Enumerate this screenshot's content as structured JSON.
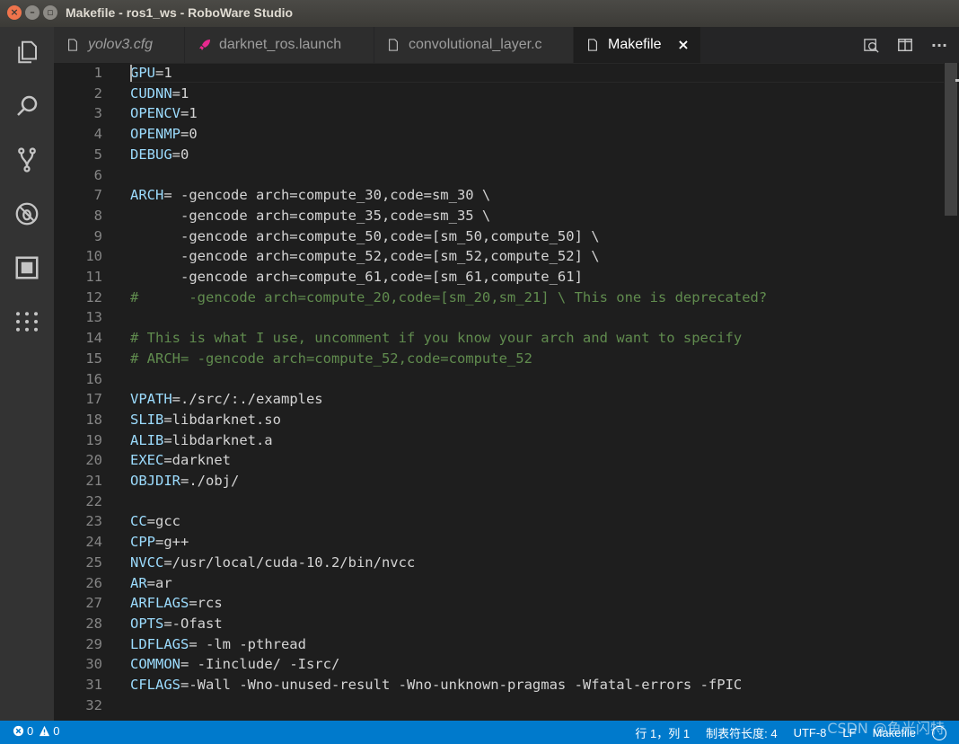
{
  "window": {
    "title": "Makefile - ros1_ws - RoboWare Studio"
  },
  "activity_bar": {
    "items": [
      "explorer-icon",
      "search-icon",
      "source-control-icon",
      "debug-icon",
      "extensions-icon",
      "more-apps-icon"
    ]
  },
  "tabs": [
    {
      "label": "yolov3.cfg",
      "icon": "file-icon",
      "italic": true,
      "active": false
    },
    {
      "label": "darknet_ros.launch",
      "icon": "rocket-icon",
      "italic": false,
      "active": false
    },
    {
      "label": "convolutional_layer.c",
      "icon": "file-icon",
      "italic": false,
      "active": false
    },
    {
      "label": "Makefile",
      "icon": "file-icon",
      "italic": false,
      "active": true,
      "close": "×"
    }
  ],
  "tab_actions": [
    "find-in-files-icon",
    "split-editor-icon",
    "more-actions-icon"
  ],
  "tab_actions_labels": {
    "more": "···"
  },
  "editor": {
    "lines": [
      {
        "n": "1",
        "t": [
          [
            "v",
            "GPU"
          ],
          [
            "x",
            "=1"
          ]
        ]
      },
      {
        "n": "2",
        "t": [
          [
            "v",
            "CUDNN"
          ],
          [
            "x",
            "=1"
          ]
        ]
      },
      {
        "n": "3",
        "t": [
          [
            "v",
            "OPENCV"
          ],
          [
            "x",
            "=1"
          ]
        ]
      },
      {
        "n": "4",
        "t": [
          [
            "v",
            "OPENMP"
          ],
          [
            "x",
            "=0"
          ]
        ]
      },
      {
        "n": "5",
        "t": [
          [
            "v",
            "DEBUG"
          ],
          [
            "x",
            "=0"
          ]
        ]
      },
      {
        "n": "6",
        "t": []
      },
      {
        "n": "7",
        "t": [
          [
            "v",
            "ARCH"
          ],
          [
            "x",
            "= -gencode arch=compute_30,code=sm_30 \\"
          ]
        ]
      },
      {
        "n": "8",
        "t": [
          [
            "x",
            "      -gencode arch=compute_35,code=sm_35 \\"
          ]
        ]
      },
      {
        "n": "9",
        "t": [
          [
            "x",
            "      -gencode arch=compute_50,code=[sm_50,compute_50] \\"
          ]
        ]
      },
      {
        "n": "10",
        "t": [
          [
            "x",
            "      -gencode arch=compute_52,code=[sm_52,compute_52] \\"
          ]
        ]
      },
      {
        "n": "11",
        "t": [
          [
            "x",
            "      -gencode arch=compute_61,code=[sm_61,compute_61]"
          ]
        ]
      },
      {
        "n": "12",
        "t": [
          [
            "c",
            "#      -gencode arch=compute_20,code=[sm_20,sm_21] \\ This one is deprecated?"
          ]
        ]
      },
      {
        "n": "13",
        "t": []
      },
      {
        "n": "14",
        "t": [
          [
            "c",
            "# This is what I use, uncomment if you know your arch and want to specify"
          ]
        ]
      },
      {
        "n": "15",
        "t": [
          [
            "c",
            "# ARCH= -gencode arch=compute_52,code=compute_52"
          ]
        ]
      },
      {
        "n": "16",
        "t": []
      },
      {
        "n": "17",
        "t": [
          [
            "v",
            "VPATH"
          ],
          [
            "x",
            "=./src/:./examples"
          ]
        ]
      },
      {
        "n": "18",
        "t": [
          [
            "v",
            "SLIB"
          ],
          [
            "x",
            "=libdarknet.so"
          ]
        ]
      },
      {
        "n": "19",
        "t": [
          [
            "v",
            "ALIB"
          ],
          [
            "x",
            "=libdarknet.a"
          ]
        ]
      },
      {
        "n": "20",
        "t": [
          [
            "v",
            "EXEC"
          ],
          [
            "x",
            "=darknet"
          ]
        ]
      },
      {
        "n": "21",
        "t": [
          [
            "v",
            "OBJDIR"
          ],
          [
            "x",
            "=./obj/"
          ]
        ]
      },
      {
        "n": "22",
        "t": []
      },
      {
        "n": "23",
        "t": [
          [
            "v",
            "CC"
          ],
          [
            "x",
            "=gcc"
          ]
        ]
      },
      {
        "n": "24",
        "t": [
          [
            "v",
            "CPP"
          ],
          [
            "x",
            "=g++"
          ]
        ]
      },
      {
        "n": "25",
        "t": [
          [
            "v",
            "NVCC"
          ],
          [
            "x",
            "=/usr/local/cuda-10.2/bin/nvcc"
          ]
        ]
      },
      {
        "n": "26",
        "t": [
          [
            "v",
            "AR"
          ],
          [
            "x",
            "=ar"
          ]
        ]
      },
      {
        "n": "27",
        "t": [
          [
            "v",
            "ARFLAGS"
          ],
          [
            "x",
            "=rcs"
          ]
        ]
      },
      {
        "n": "28",
        "t": [
          [
            "v",
            "OPTS"
          ],
          [
            "x",
            "=-Ofast"
          ]
        ]
      },
      {
        "n": "29",
        "t": [
          [
            "v",
            "LDFLAGS"
          ],
          [
            "x",
            "= -lm -pthread"
          ]
        ]
      },
      {
        "n": "30",
        "t": [
          [
            "v",
            "COMMON"
          ],
          [
            "x",
            "= -Iinclude/ -Isrc/"
          ]
        ]
      },
      {
        "n": "31",
        "t": [
          [
            "v",
            "CFLAGS"
          ],
          [
            "x",
            "=-Wall -Wno-unused-result -Wno-unknown-pragmas -Wfatal-errors -fPIC"
          ]
        ]
      },
      {
        "n": "32",
        "t": []
      }
    ]
  },
  "status": {
    "errors": "0",
    "warnings": "0",
    "position": "行 1，列 1",
    "tab_size": "制表符长度: 4",
    "encoding": "UTF-8",
    "eol": "LF",
    "language": "Makefile"
  },
  "watermark": "CSDN @鱼光闪特",
  "colors": {
    "statusbar": "#007acc",
    "variable": "#9cdcfe",
    "comment": "#608b4e",
    "text": "#d4d4d4"
  }
}
